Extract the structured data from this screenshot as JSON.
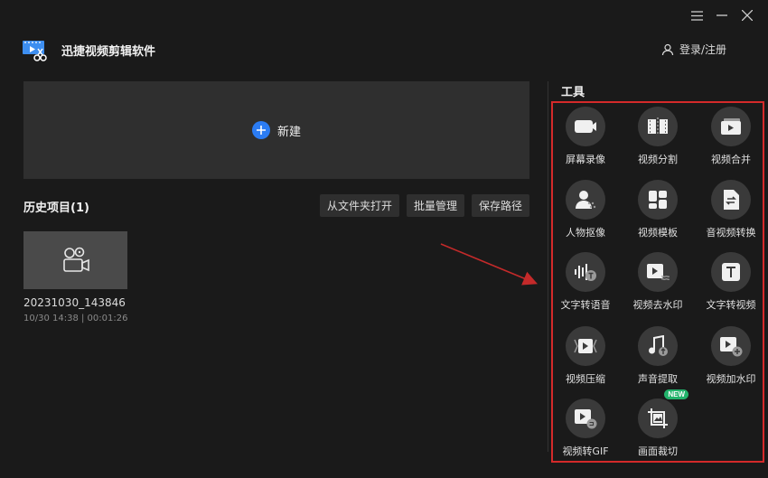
{
  "app": {
    "title": "迅捷视频剪辑软件"
  },
  "header": {
    "login_label": "登录/注册"
  },
  "new_project": {
    "label": "新建"
  },
  "history": {
    "title": "历史项目(1)",
    "actions": [
      "从文件夹打开",
      "批量管理",
      "保存路径"
    ],
    "projects": [
      {
        "name": "20231030_143846",
        "meta": "10/30 14:38 | 00:01:26"
      }
    ]
  },
  "tools": {
    "title": "工具",
    "items": [
      {
        "label": "屏幕录像",
        "icon": "screen-record-icon"
      },
      {
        "label": "视频分割",
        "icon": "video-split-icon"
      },
      {
        "label": "视频合并",
        "icon": "video-merge-icon"
      },
      {
        "label": "人物抠像",
        "icon": "person-cutout-icon"
      },
      {
        "label": "视频模板",
        "icon": "video-template-icon"
      },
      {
        "label": "音视频转换",
        "icon": "av-convert-icon"
      },
      {
        "label": "文字转语音",
        "icon": "text-to-speech-icon"
      },
      {
        "label": "视频去水印",
        "icon": "remove-watermark-icon"
      },
      {
        "label": "文字转视频",
        "icon": "text-to-video-icon"
      },
      {
        "label": "视频压缩",
        "icon": "video-compress-icon"
      },
      {
        "label": "声音提取",
        "icon": "audio-extract-icon"
      },
      {
        "label": "视频加水印",
        "icon": "add-watermark-icon"
      },
      {
        "label": "视频转GIF",
        "icon": "video-to-gif-icon"
      },
      {
        "label": "画面裁切",
        "icon": "crop-icon",
        "badge": "NEW"
      }
    ]
  },
  "colors": {
    "accent": "#2b7cf3",
    "highlight_border": "#d42a2a",
    "badge": "#22b36b"
  }
}
